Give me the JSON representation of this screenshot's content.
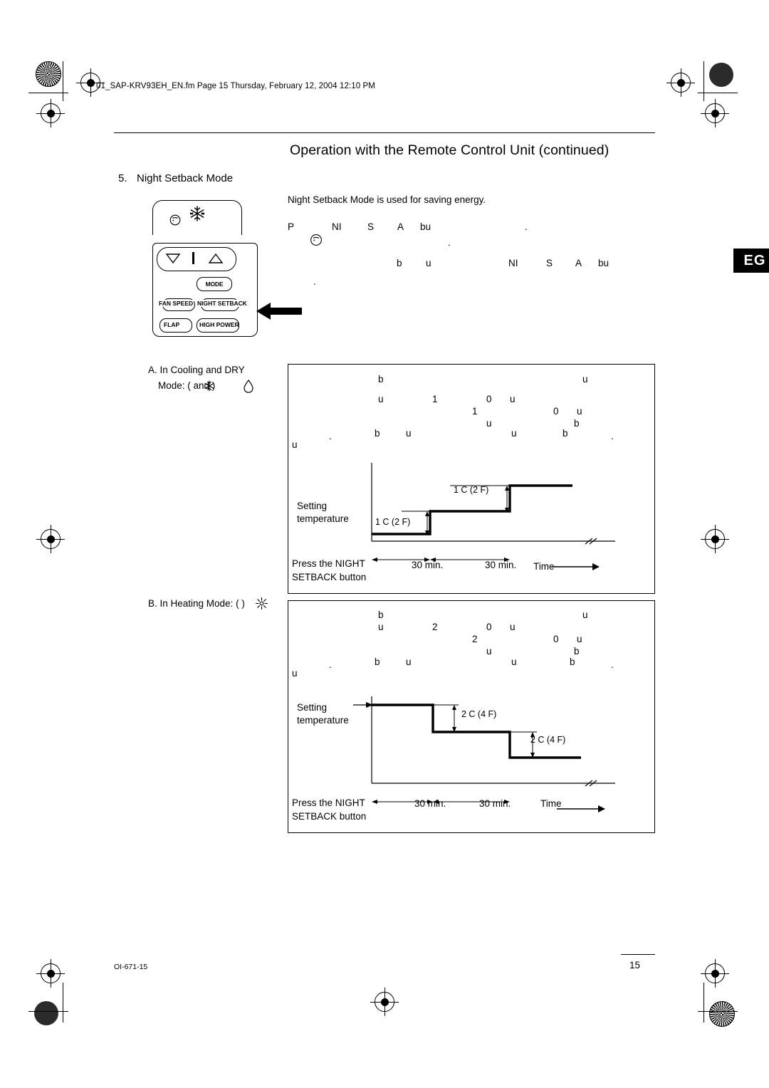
{
  "header": {
    "file_line": "01_SAP-KRV93EH_EN.fm  Page 15  Thursday, February 12, 2004  12:10 PM"
  },
  "title": "Operation with the Remote Control Unit (continued)",
  "section": {
    "number": "5.",
    "heading": "Night Setback Mode",
    "intro": "Night Setback Mode is used for saving energy."
  },
  "paragraphs": {
    "p1_a": "P",
    "p1_b": "NI",
    "p1_c": "S",
    "p1_d": "A",
    "p1_e": "bu",
    "p1_f": ".",
    "p2_a": "b",
    "p2_b": "u",
    "p2_c": "NI",
    "p2_d": "S",
    "p2_e": "A",
    "p2_f": "bu",
    "p3": "."
  },
  "eg_tab": "EG",
  "remote": {
    "mode_button": "MODE",
    "fan_speed": "FAN SPEED",
    "night_setback": "NIGHT SETBACK",
    "flap": "FLAP",
    "high_power": "HIGH POWER"
  },
  "sections": {
    "a_label_line1": "A. In Cooling and DRY",
    "a_label_line2": "Mode: (        and       )",
    "b_label": "B. In Heating Mode: (        )"
  },
  "diagram_a": {
    "frag_1": "b",
    "frag_2": "u",
    "frag_3": "u",
    "frag_4": "1",
    "frag_5": "0",
    "frag_6": "u",
    "frag_7": "1",
    "frag_8": "0",
    "frag_9": "u",
    "frag_10": "u",
    "frag_11": "b",
    "frag_12": "u",
    "frag_13": ".",
    "frag_14": "b",
    "frag_15": "u",
    "frag_16": "u",
    "frag_17": "b",
    "frag_18": ".",
    "setting": "Setting",
    "temperature": "temperature",
    "step1_label": "1  C (2  F)",
    "step2_label": "1  C (2  F)",
    "press_line1": "Press the NIGHT",
    "press_line2": "SETBACK button",
    "time_label": "Time",
    "interval1": "30 min.",
    "interval2": "30 min."
  },
  "diagram_b": {
    "frag_1": "b",
    "frag_2": "u",
    "frag_3": "u",
    "frag_4": "2",
    "frag_5": "0",
    "frag_6": "u",
    "frag_7": "2",
    "frag_8": "0",
    "frag_9": "u",
    "frag_10": "u",
    "frag_11": "b",
    "frag_12": "u",
    "frag_13": ".",
    "frag_14": "b",
    "frag_15": "u",
    "frag_16": "u",
    "frag_17": "b",
    "frag_18": ".",
    "setting": "Setting",
    "temperature": "temperature",
    "step1_label": "2  C (4  F)",
    "step2_label": "2  C (4  F)",
    "press_line1": "Press the NIGHT",
    "press_line2": "SETBACK button",
    "time_label": "Time",
    "interval1": "30 min.",
    "interval2": "30 min."
  },
  "footer": {
    "code": "OI-671-15",
    "page": "15"
  }
}
